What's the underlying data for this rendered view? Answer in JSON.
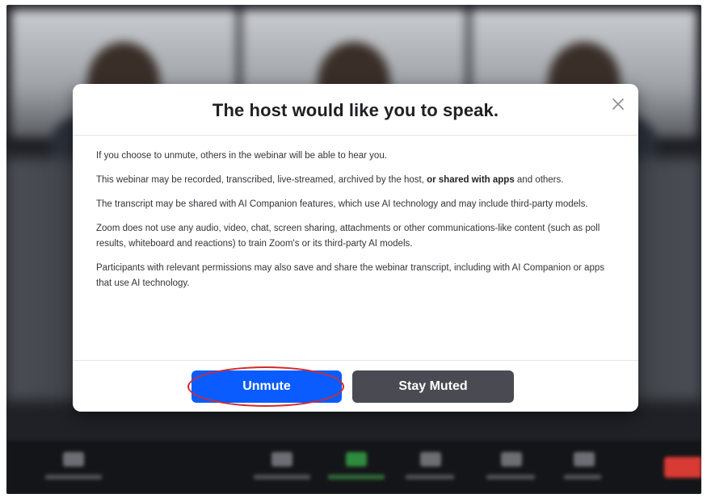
{
  "dialog": {
    "title": "The host would like you to speak.",
    "paragraphs": {
      "p1": "If you choose to unmute, others in the webinar will be able to hear you.",
      "p2_a": "This webinar may be recorded, transcribed, live-streamed, archived by the host, ",
      "p2_bold": "or shared with apps",
      "p2_b": " and others.",
      "p3": "The transcript may be shared with AI Companion features, which use AI technology and may include third-party models.",
      "p4": "Zoom does not use any audio, video, chat, screen sharing, attachments or other communications-like content (such as poll results, whiteboard and reactions) to train Zoom's or its third-party AI models.",
      "p5": "Participants with relevant permissions may also save and share the webinar transcript, including with AI Companion or apps that use AI technology."
    },
    "buttons": {
      "unmute": "Unmute",
      "stay_muted": "Stay Muted"
    }
  },
  "colors": {
    "primary": "#0b5cff",
    "secondary": "#4a4b52",
    "highlight": "#d42a2a",
    "end": "#d83a34"
  },
  "icons": {
    "close": "close-icon"
  }
}
